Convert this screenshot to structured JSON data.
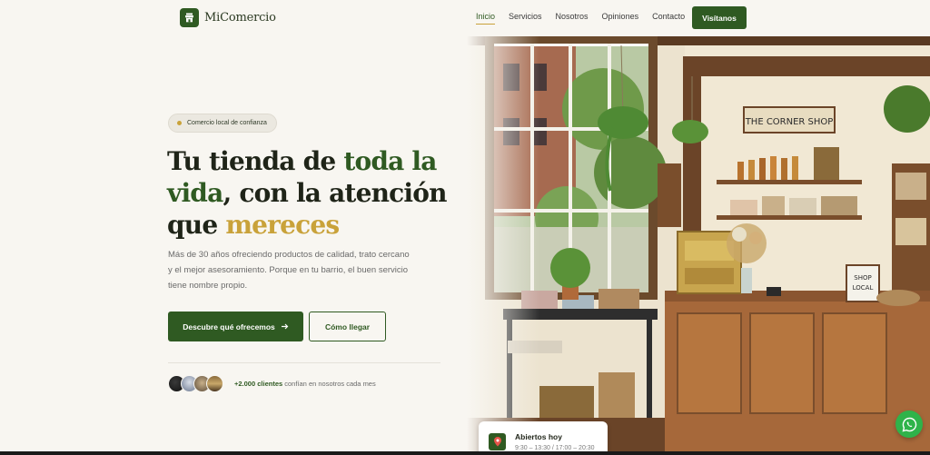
{
  "header": {
    "brand": "MiComercio",
    "nav": [
      {
        "label": "Inicio",
        "active": true
      },
      {
        "label": "Servicios",
        "active": false
      },
      {
        "label": "Nosotros",
        "active": false
      },
      {
        "label": "Opiniones",
        "active": false
      },
      {
        "label": "Contacto",
        "active": false
      }
    ],
    "cta": "Visítanos"
  },
  "hero": {
    "badge": "Comercio local de confianza",
    "headline": {
      "part1": "Tu tienda de ",
      "highlight1": "toda la vida",
      "part2": ", con la atención que ",
      "highlight2": "mereces"
    },
    "description": "Más de 30 años ofreciendo productos de calidad, trato cercano y el mejor asesoramiento. Porque en tu barrio, el buen servicio tiene nombre propio.",
    "primary_cta": "Descubre qué ofrecemos",
    "secondary_cta": "Cómo llegar",
    "social_proof_bold": "+2.000 clientes",
    "social_proof_rest": " confían en nosotros cada mes"
  },
  "image": {
    "sign_text": "THE CORNER SHOP",
    "sign_small_line1": "SHOP",
    "sign_small_line2": "LOCAL"
  },
  "hours_card": {
    "title": "Abiertos hoy",
    "time": "9:30 – 13:30 / 17:00 – 20:30"
  },
  "colors": {
    "primary": "#2f5a22",
    "accent": "#c9a23a",
    "background": "#f8f6f1",
    "whatsapp": "#2fb34a"
  },
  "icons": [
    "store-icon",
    "arrow-right-icon",
    "map-pin-icon",
    "whatsapp-icon"
  ]
}
